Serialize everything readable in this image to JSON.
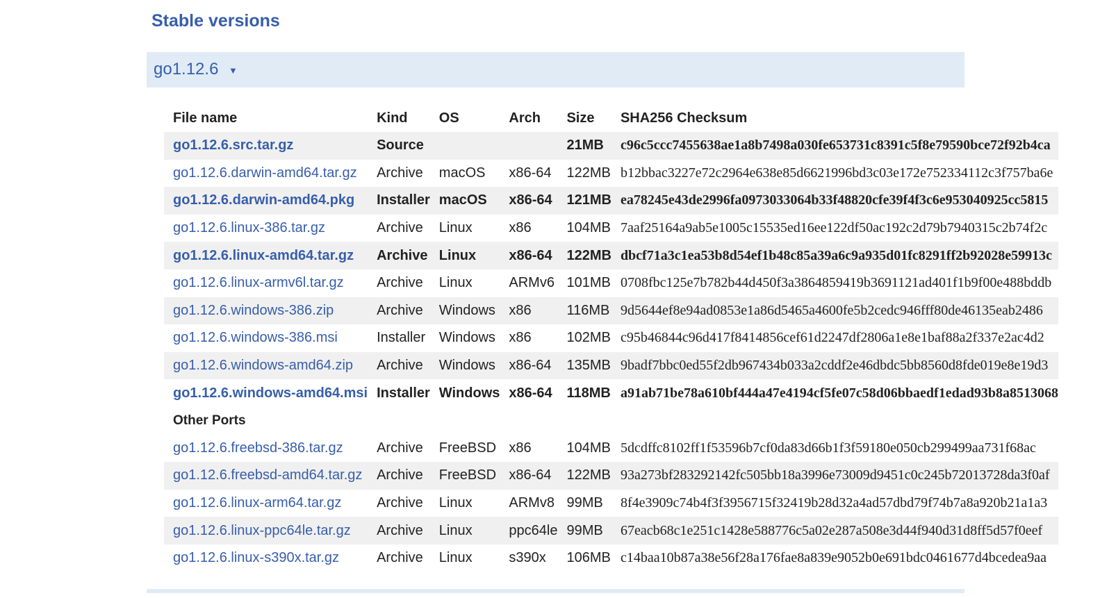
{
  "page": {
    "section_title": "Stable versions",
    "version": {
      "label": "go1.12.6",
      "toggle_icon": "▼"
    }
  },
  "table": {
    "headers": {
      "file_name": "File name",
      "kind": "Kind",
      "os": "OS",
      "arch": "Arch",
      "size": "Size",
      "checksum": "SHA256 Checksum"
    },
    "rows": [
      {
        "file": "go1.12.6.src.tar.gz",
        "kind": "Source",
        "os": "",
        "arch": "",
        "size": "21MB",
        "checksum": "c96c5ccc7455638ae1a8b7498a030fe653731c8391c5f8e79590bce72f92b4ca",
        "highlight": true
      },
      {
        "file": "go1.12.6.darwin-amd64.tar.gz",
        "kind": "Archive",
        "os": "macOS",
        "arch": "x86-64",
        "size": "122MB",
        "checksum": "b12bbac3227e72c2964e638e85d6621996bd3c03e172e752334112c3f757ba6e",
        "highlight": false
      },
      {
        "file": "go1.12.6.darwin-amd64.pkg",
        "kind": "Installer",
        "os": "macOS",
        "arch": "x86-64",
        "size": "121MB",
        "checksum": "ea78245e43de2996fa0973033064b33f48820cfe39f4f3c6e953040925cc5815",
        "highlight": true
      },
      {
        "file": "go1.12.6.linux-386.tar.gz",
        "kind": "Archive",
        "os": "Linux",
        "arch": "x86",
        "size": "104MB",
        "checksum": "7aaf25164a9ab5e1005c15535ed16ee122df50ac192c2d79b7940315c2b74f2c",
        "highlight": false
      },
      {
        "file": "go1.12.6.linux-amd64.tar.gz",
        "kind": "Archive",
        "os": "Linux",
        "arch": "x86-64",
        "size": "122MB",
        "checksum": "dbcf71a3c1ea53b8d54ef1b48c85a39a6c9a935d01fc8291ff2b92028e59913c",
        "highlight": true
      },
      {
        "file": "go1.12.6.linux-armv6l.tar.gz",
        "kind": "Archive",
        "os": "Linux",
        "arch": "ARMv6",
        "size": "101MB",
        "checksum": "0708fbc125e7b782b44d450f3a3864859419b3691121ad401f1b9f00e488bddb",
        "highlight": false
      },
      {
        "file": "go1.12.6.windows-386.zip",
        "kind": "Archive",
        "os": "Windows",
        "arch": "x86",
        "size": "116MB",
        "checksum": "9d5644ef8e94ad0853e1a86d5465a4600fe5b2cedc946fff80de46135eab2486",
        "highlight": false
      },
      {
        "file": "go1.12.6.windows-386.msi",
        "kind": "Installer",
        "os": "Windows",
        "arch": "x86",
        "size": "102MB",
        "checksum": "c95b46844c96d417f8414856cef61d2247df2806a1e8e1baf88a2f337e2ac4d2",
        "highlight": false
      },
      {
        "file": "go1.12.6.windows-amd64.zip",
        "kind": "Archive",
        "os": "Windows",
        "arch": "x86-64",
        "size": "135MB",
        "checksum": "9badf7bbc0ed55f2db967434b033a2cddf2e46dbdc5bb8560d8fde019e8e19d3",
        "highlight": false
      },
      {
        "file": "go1.12.6.windows-amd64.msi",
        "kind": "Installer",
        "os": "Windows",
        "arch": "x86-64",
        "size": "118MB",
        "checksum": "a91ab71be78a610bf444a47e4194cf5fe07c58d06bbaedf1edad93b8a8513068",
        "highlight": true
      }
    ],
    "other_ports_label": "Other Ports",
    "other_rows": [
      {
        "file": "go1.12.6.freebsd-386.tar.gz",
        "kind": "Archive",
        "os": "FreeBSD",
        "arch": "x86",
        "size": "104MB",
        "checksum": "5dcdffc8102ff1f53596b7cf0da83d66b1f3f59180e050cb299499aa731f68ac",
        "highlight": false
      },
      {
        "file": "go1.12.6.freebsd-amd64.tar.gz",
        "kind": "Archive",
        "os": "FreeBSD",
        "arch": "x86-64",
        "size": "122MB",
        "checksum": "93a273bf283292142fc505bb18a3996e73009d9451c0c245b72013728da3f0af",
        "highlight": false
      },
      {
        "file": "go1.12.6.linux-arm64.tar.gz",
        "kind": "Archive",
        "os": "Linux",
        "arch": "ARMv8",
        "size": "99MB",
        "checksum": "8f4e3909c74b4f3f3956715f32419b28d32a4ad57dbd79f74b7a8a920b21a1a3",
        "highlight": false
      },
      {
        "file": "go1.12.6.linux-ppc64le.tar.gz",
        "kind": "Archive",
        "os": "Linux",
        "arch": "ppc64le",
        "size": "99MB",
        "checksum": "67eacb68c1e251c1428e588776c5a02e287a508e3d44f940d31d8ff5d57f0eef",
        "highlight": false
      },
      {
        "file": "go1.12.6.linux-s390x.tar.gz",
        "kind": "Archive",
        "os": "Linux",
        "arch": "s390x",
        "size": "106MB",
        "checksum": "c14baa10b87a38e56f28a176fae8a839e9052b0e691bdc0461677d4bcedea9aa",
        "highlight": false
      }
    ]
  },
  "colors": {
    "link": "#375eab",
    "header_bg": "#e0ebf5",
    "row_alt": "#f0f0f0",
    "text": "#222222"
  }
}
